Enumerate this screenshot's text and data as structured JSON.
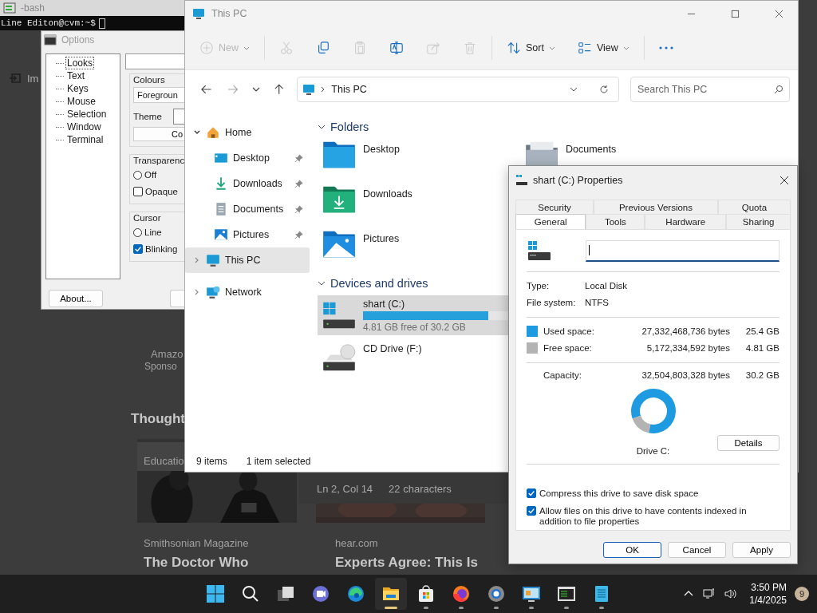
{
  "terminal": {
    "title": "-bash",
    "prompt": "Line Editon@cvm:~$"
  },
  "browser_page": {
    "import_label": "Im",
    "ad_name": "Amazo",
    "ad_label": "Sponso",
    "heading": "Thought",
    "tag": "Educatio",
    "articles": [
      {
        "source": "Smithsonian Magazine",
        "title": "The Doctor Who"
      },
      {
        "source": "hear.com",
        "title": "Experts Agree: This Is"
      }
    ]
  },
  "editor_status": {
    "position": "Ln 2, Col 14",
    "count": "22 characters"
  },
  "options_window": {
    "title": "Options",
    "tree": [
      {
        "label": "Looks",
        "selected": true
      },
      {
        "label": "Text",
        "selected": false
      },
      {
        "label": "Keys",
        "selected": false
      },
      {
        "label": "Mouse",
        "selected": false
      },
      {
        "label": "Selection",
        "selected": false
      },
      {
        "label": "Window",
        "selected": false
      },
      {
        "label": "Terminal",
        "selected": false
      }
    ],
    "colours": {
      "title": "Colours",
      "select": "Foregroun",
      "theme_label": "Theme",
      "button": "Co"
    },
    "groups": [
      {
        "title": "Transparenc",
        "options": [
          {
            "label": "Off",
            "kind": "radio",
            "checked": false
          },
          {
            "label": "Opaque",
            "kind": "checkbox",
            "checked": false
          }
        ]
      },
      {
        "title": "Cursor",
        "options": [
          {
            "label": "Line",
            "kind": "radio",
            "checked": false
          },
          {
            "label": "Blinking",
            "kind": "checkbox",
            "checked": true
          }
        ]
      }
    ],
    "about_button": "About..."
  },
  "explorer": {
    "title": "This PC",
    "toolbar": [
      {
        "kind": "new",
        "label": "New",
        "disabled": true
      },
      {
        "kind": "cut",
        "disabled": true
      },
      {
        "kind": "copy",
        "disabled": false
      },
      {
        "kind": "paste",
        "disabled": true
      },
      {
        "kind": "rename",
        "disabled": false
      },
      {
        "kind": "share",
        "disabled": true
      },
      {
        "kind": "delete",
        "disabled": true
      },
      {
        "kind": "sort",
        "label": "Sort",
        "disabled": false
      },
      {
        "kind": "view",
        "label": "View",
        "disabled": false
      },
      {
        "kind": "more",
        "disabled": false
      }
    ],
    "address": {
      "path": "This PC"
    },
    "search": {
      "placeholder": "Search This PC"
    },
    "nav": [
      {
        "label": "Home",
        "kind": "home",
        "expanded": true,
        "selected": false,
        "children": [
          {
            "label": "Desktop",
            "kind": "desktop",
            "pinned": true,
            "selected": false
          },
          {
            "label": "Downloads",
            "kind": "downloads",
            "pinned": true,
            "selected": false
          },
          {
            "label": "Documents",
            "kind": "documents",
            "pinned": true,
            "selected": false
          },
          {
            "label": "Pictures",
            "kind": "pictures",
            "pinned": true,
            "selected": false
          }
        ]
      },
      {
        "label": "This PC",
        "kind": "pc",
        "expanded": false,
        "selected": true
      },
      {
        "label": "Network",
        "kind": "network",
        "expanded": false,
        "selected": false
      }
    ],
    "folders": {
      "title": "Folders",
      "expanded": true,
      "items": [
        {
          "name": "Desktop",
          "kind": "desktop"
        },
        {
          "name": "Downloads",
          "kind": "downloads"
        },
        {
          "name": "Pictures",
          "kind": "pictures"
        },
        {
          "name": "Documents",
          "kind": "documents"
        }
      ]
    },
    "drives": {
      "title": "Devices and drives",
      "expanded": true,
      "items": [
        {
          "name": "shart (C:)",
          "kind": "system",
          "selected": true,
          "level": 0.84,
          "free": "4.81 GB free of 30.2 GB"
        },
        {
          "name": "CD Drive (F:)",
          "kind": "cd",
          "selected": false
        }
      ]
    },
    "status": {
      "count": "9 items",
      "selection": "1 item selected"
    }
  },
  "properties": {
    "title": "shart (C:) Properties",
    "tabs_back": [
      {
        "label": "Security",
        "selected": false
      },
      {
        "label": "Previous Versions",
        "selected": false
      },
      {
        "label": "Quota",
        "selected": false
      }
    ],
    "tabs_front": [
      {
        "label": "General",
        "selected": true
      },
      {
        "label": "Tools",
        "selected": false
      },
      {
        "label": "Hardware",
        "selected": false
      },
      {
        "label": "Sharing",
        "selected": false
      }
    ],
    "info": [
      {
        "label": "Type:",
        "value": "Local Disk"
      },
      {
        "label": "File system:",
        "value": "NTFS"
      }
    ],
    "space": [
      {
        "label": "Used space:",
        "bytes": "27,332,468,736 bytes",
        "size": "25.4 GB",
        "color": "#1e9be0"
      },
      {
        "label": "Free space:",
        "bytes": "5,172,334,592 bytes",
        "size": "4.81 GB",
        "color": "#b3b3b3"
      }
    ],
    "capacity": {
      "label": "Capacity:",
      "bytes": "32,504,803,328 bytes",
      "size": "30.2 GB"
    },
    "drive_label": "Drive C:",
    "details_button": "Details",
    "checks": [
      {
        "label": "Compress this drive to save disk space",
        "checked": true
      },
      {
        "label": "Allow files on this drive to have contents indexed in addition to file properties",
        "checked": true
      }
    ],
    "buttons": [
      {
        "label": "OK",
        "kind": "default"
      },
      {
        "label": "Cancel",
        "kind": "normal"
      },
      {
        "label": "Apply",
        "kind": "normal"
      }
    ]
  },
  "taskbar": {
    "apps": [
      {
        "kind": "start",
        "active": false,
        "running": false
      },
      {
        "kind": "search",
        "active": false,
        "running": false
      },
      {
        "kind": "taskview",
        "active": false,
        "running": false
      },
      {
        "kind": "chat",
        "active": false,
        "running": false
      },
      {
        "kind": "edge",
        "active": false,
        "running": false
      },
      {
        "kind": "explorer",
        "active": true,
        "running": true
      },
      {
        "kind": "store",
        "active": false,
        "running": true
      },
      {
        "kind": "firefox",
        "active": false,
        "running": true
      },
      {
        "kind": "gear",
        "active": false,
        "running": true
      },
      {
        "kind": "remote",
        "active": false,
        "running": true
      },
      {
        "kind": "terminal",
        "active": false,
        "running": true
      },
      {
        "kind": "notepad",
        "active": false,
        "running": true
      }
    ],
    "time": "3:50 PM",
    "date": "1/4/2025",
    "badge": "9"
  }
}
